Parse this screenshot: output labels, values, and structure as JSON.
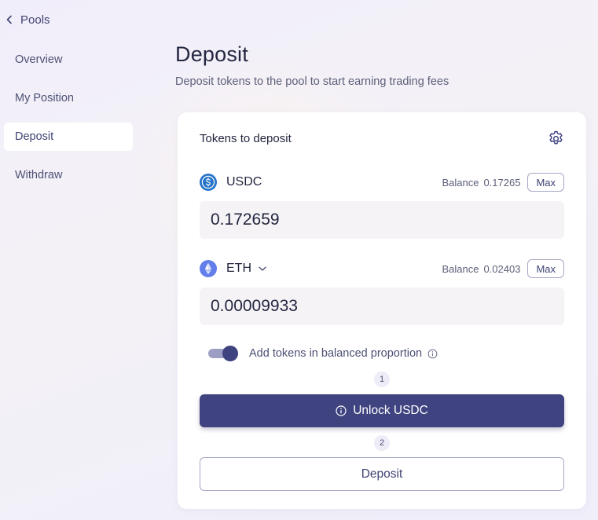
{
  "sidebar": {
    "back_label": "Pools",
    "items": [
      {
        "label": "Overview",
        "active": false
      },
      {
        "label": "My Position",
        "active": false
      },
      {
        "label": "Deposit",
        "active": true
      },
      {
        "label": "Withdraw",
        "active": false
      }
    ]
  },
  "header": {
    "title": "Deposit",
    "subtitle": "Deposit tokens to the pool to start earning trading fees"
  },
  "card": {
    "title": "Tokens to deposit",
    "settings_icon": "gear-icon",
    "tokens": [
      {
        "symbol": "USDC",
        "icon": "usdc-icon",
        "balance_label": "Balance",
        "balance": "0.17265",
        "max_label": "Max",
        "amount": "0.172659",
        "has_dropdown": false
      },
      {
        "symbol": "ETH",
        "icon": "eth-icon",
        "balance_label": "Balance",
        "balance": "0.02403",
        "max_label": "Max",
        "amount": "0.00009933",
        "has_dropdown": true
      }
    ],
    "balanced_toggle": {
      "label": "Add tokens in balanced proportion",
      "on": true
    },
    "steps": [
      {
        "number": "1",
        "button_label": "Unlock USDC"
      },
      {
        "number": "2",
        "button_label": "Deposit"
      }
    ]
  },
  "colors": {
    "accent": "#3f4380",
    "usdc": "#2775ca",
    "eth": "#627eea"
  }
}
